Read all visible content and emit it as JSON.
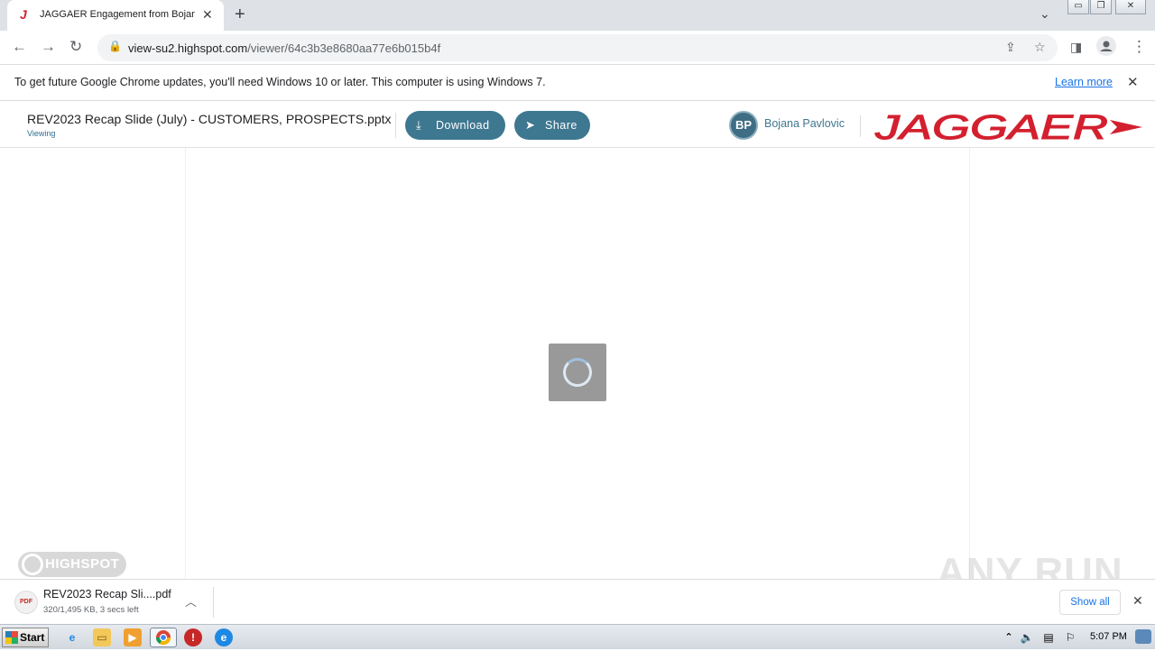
{
  "browser": {
    "tab_title": "JAGGAER Engagement from Bojana",
    "url_host": "view-su2.highspot.com",
    "url_path": "/viewer/64c3b3e8680aa77e6b015b4f"
  },
  "infobar": {
    "message": "To get future Google Chrome updates, you'll need Windows 10 or later. This computer is using Windows 7.",
    "link": "Learn more"
  },
  "viewer": {
    "document_title": "REV2023 Recap Slide (July) - CUSTOMERS, PROSPECTS.pptx",
    "status": "Viewing",
    "download_label": "Download",
    "share_label": "Share",
    "user_initials": "BP",
    "user_name": "Bojana Pavlovic",
    "brand_logo": "JAGGAER",
    "brand_color": "#d3202f",
    "accent_color": "#3e7790"
  },
  "content": {
    "badge": "HIGHSPOT",
    "watermark": "ANY RUN"
  },
  "download_shelf": {
    "file_name": "REV2023 Recap Sli....pdf",
    "file_status": "320/1,495 KB, 3 secs left",
    "file_type": "PDF",
    "show_all": "Show all"
  },
  "taskbar": {
    "start_label": "Start",
    "clock": "5:07 PM"
  }
}
